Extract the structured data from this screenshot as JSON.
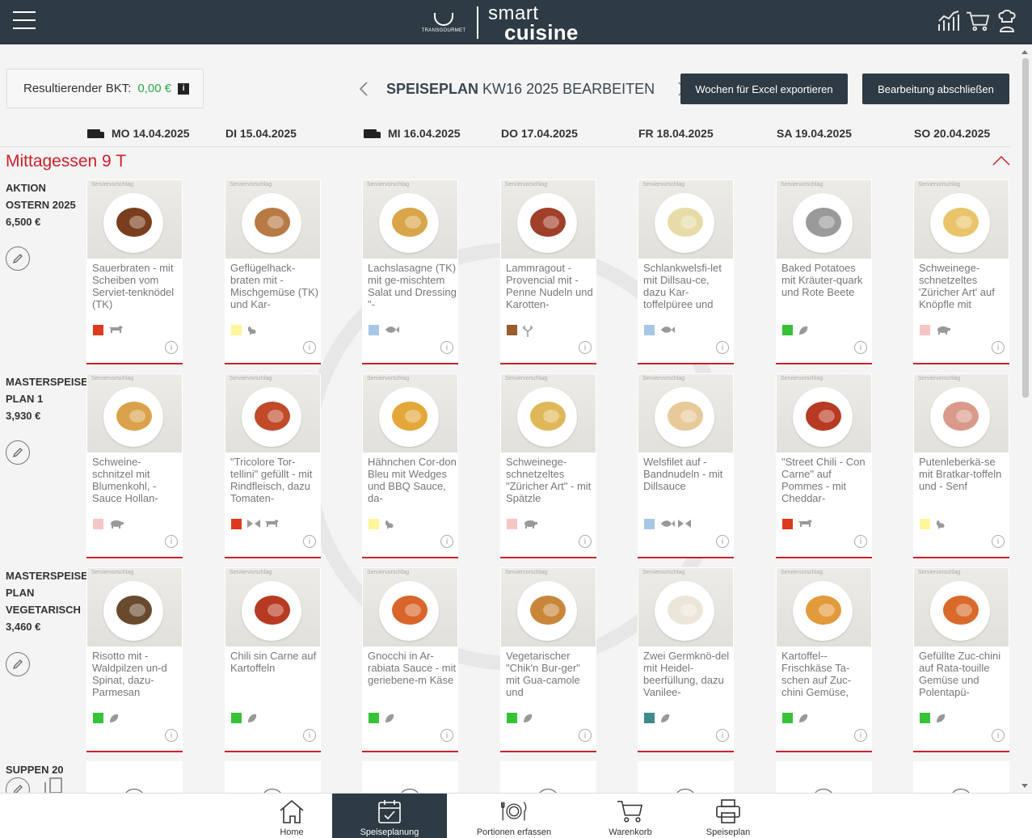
{
  "header": {
    "logo_brand": "TRANSGOURMET",
    "logo_word1": "smart",
    "logo_word2": "cuisine",
    "icons": [
      "bar-chart-icon",
      "cart-icon",
      "chef-icon"
    ]
  },
  "bkt": {
    "label": "Resultierender BKT:",
    "value": "0,00 €",
    "info": "i"
  },
  "plan": {
    "title_bold": "SPEISEPLAN",
    "title_rest": "KW16 2025 BEARBEITEN"
  },
  "buttons": {
    "export": "Wochen für Excel exportieren",
    "finish": "Bearbeitung abschließen"
  },
  "days": [
    {
      "label": "MO 14.04.2025",
      "truck": true
    },
    {
      "label": "DI 15.04.2025",
      "truck": false
    },
    {
      "label": "MI 16.04.2025",
      "truck": true
    },
    {
      "label": "DO 17.04.2025",
      "truck": false
    },
    {
      "label": "FR 18.04.2025",
      "truck": false
    },
    {
      "label": "SA 19.04.2025",
      "truck": false
    },
    {
      "label": "SO 20.04.2025",
      "truck": false
    }
  ],
  "section": {
    "title": "Mittagessen 9 T"
  },
  "serving_tag": "Serviervorschlag",
  "rows": [
    {
      "label_lines": [
        "AKTION",
        "OSTERN 2025",
        "6,500 €"
      ],
      "items": [
        {
          "name": "Sauerbraten - mit Scheiben vom Serviet-tenknödel (TK)",
          "color": "#e03a1e",
          "icons": [
            "cow-icon"
          ],
          "food": "#7a3e1e"
        },
        {
          "name": "Geflügelhack-braten mit - Mischgemüse (TK) und Kar-",
          "color": "#fff59a",
          "icons": [
            "chicken-icon"
          ],
          "food": "#b87a44"
        },
        {
          "name": "Lachslasagne (TK) mit ge-mischtem Salat und Dressing \"-",
          "color": "#a7c7e7",
          "icons": [
            "fish-icon"
          ],
          "food": "#d9a54a"
        },
        {
          "name": "Lammragout - Provencial mit - Penne Nudeln und Karotten-",
          "color": "#9a5b2e",
          "icons": [
            "deer-icon"
          ],
          "food": "#a0402a"
        },
        {
          "name": "Schlankwelsfi-let mit Dillsau-ce, dazu Kar-toffelpüree und",
          "color": "#a7c7e7",
          "icons": [
            "fish-icon"
          ],
          "food": "#e7dca8"
        },
        {
          "name": "Baked Potatoes mit Kräuter-quark und Rote Beete",
          "color": "#38c238",
          "icons": [
            "leaf-icon"
          ],
          "food": "#9a9a9a"
        },
        {
          "name": "Schweinege-schnetzeltes 'Züricher Art' auf Knöpfle mit",
          "color": "#f6c6c6",
          "icons": [
            "pig-icon"
          ],
          "food": "#e9c46a"
        }
      ]
    },
    {
      "label_lines": [
        "MASTERSPEISE",
        "PLAN 1",
        "3,930 €"
      ],
      "items": [
        {
          "name": "Schweine-schnitzel mit Blumenkohl, - Sauce Hollan-",
          "color": "#f6c6c6",
          "icons": [
            "pig-icon"
          ],
          "food": "#d9a14a"
        },
        {
          "name": "\"Tricolore Tor-tellini\" gefüllt - mit Rindfleisch, dazu Tomaten-",
          "color": "#e03a1e",
          "icons": [
            "bow-icon",
            "cow-icon"
          ],
          "food": "#c24a2a"
        },
        {
          "name": "Hähnchen Cor-don Bleu mit Wedges und BBQ Sauce, da-",
          "color": "#fff59a",
          "icons": [
            "chicken-icon"
          ],
          "food": "#e3a73a"
        },
        {
          "name": "Schweinege-schnetzeltes \"Züricher Art\" - mit Spätzle",
          "color": "#f6c6c6",
          "icons": [
            "pig-icon"
          ],
          "food": "#e0b85a"
        },
        {
          "name": "Welsfilet auf - Bandnudeln - mit Dillsauce",
          "color": "#a7c7e7",
          "icons": [
            "fish-icon",
            "bow-icon"
          ],
          "food": "#e7c99a"
        },
        {
          "name": "\"Street Chili - Con Carne\" auf Pommes - mit Cheddar-",
          "color": "#e03a1e",
          "icons": [
            "cow-icon"
          ],
          "food": "#b83a22"
        },
        {
          "name": "Putenleberkä-se mit Bratkar-toffeln und - Senf",
          "color": "#fff59a",
          "icons": [
            "chicken-icon"
          ],
          "food": "#d99a8a"
        }
      ]
    },
    {
      "label_lines": [
        "MASTERSPEISE",
        "PLAN",
        "VEGETARISCH",
        "3,460 €"
      ],
      "items": [
        {
          "name": "Risotto mit - Waldpilzen un-d Spinat, dazu-Parmesan",
          "color": "#38c238",
          "icons": [
            "leaf-icon"
          ],
          "food": "#6a4a2e"
        },
        {
          "name": "Chili sin Carne auf Kartoffeln",
          "color": "#38c238",
          "icons": [
            "leaf-icon"
          ],
          "food": "#b83a22"
        },
        {
          "name": "Gnocchi in Ar-rabiata Sauce - mit geriebene-m Käse",
          "color": "#38c238",
          "icons": [
            "leaf-icon"
          ],
          "food": "#d9652a"
        },
        {
          "name": "Vegetarischer \"Chik'n Bur-ger\" mit Gua-camole und",
          "color": "#38c238",
          "icons": [
            "leaf-icon"
          ],
          "food": "#c9863a"
        },
        {
          "name": "Zwei Germknö-del mit Heidel-beerfüllung, dazu Vanilee-",
          "color": "#3e8a8a",
          "icons": [
            "leaf-icon"
          ],
          "food": "#ece6da"
        },
        {
          "name": "Kartoffel-- Frischkäse Ta-schen auf Zuc-chini Gemüse,",
          "color": "#38c238",
          "icons": [
            "leaf-icon"
          ],
          "food": "#e39a3a"
        },
        {
          "name": "Gefüllte Zuc-chini auf Rata-touille Gemüse und Polentapü-",
          "color": "#38c238",
          "icons": [
            "leaf-icon"
          ],
          "food": "#d96a2a"
        }
      ]
    }
  ],
  "soup_row": {
    "label": "SUPPEN 20"
  },
  "bottom_nav": [
    {
      "label": "Home",
      "icon": "home-icon",
      "active": false
    },
    {
      "label": "Speiseplanung",
      "icon": "calendar-icon",
      "active": true
    },
    {
      "label": "Portionen erfassen",
      "icon": "plate-cutlery-icon",
      "active": false
    },
    {
      "label": "Warenkorb",
      "icon": "cart-icon",
      "active": false
    },
    {
      "label": "Speiseplan",
      "icon": "printer-icon",
      "active": false
    }
  ]
}
